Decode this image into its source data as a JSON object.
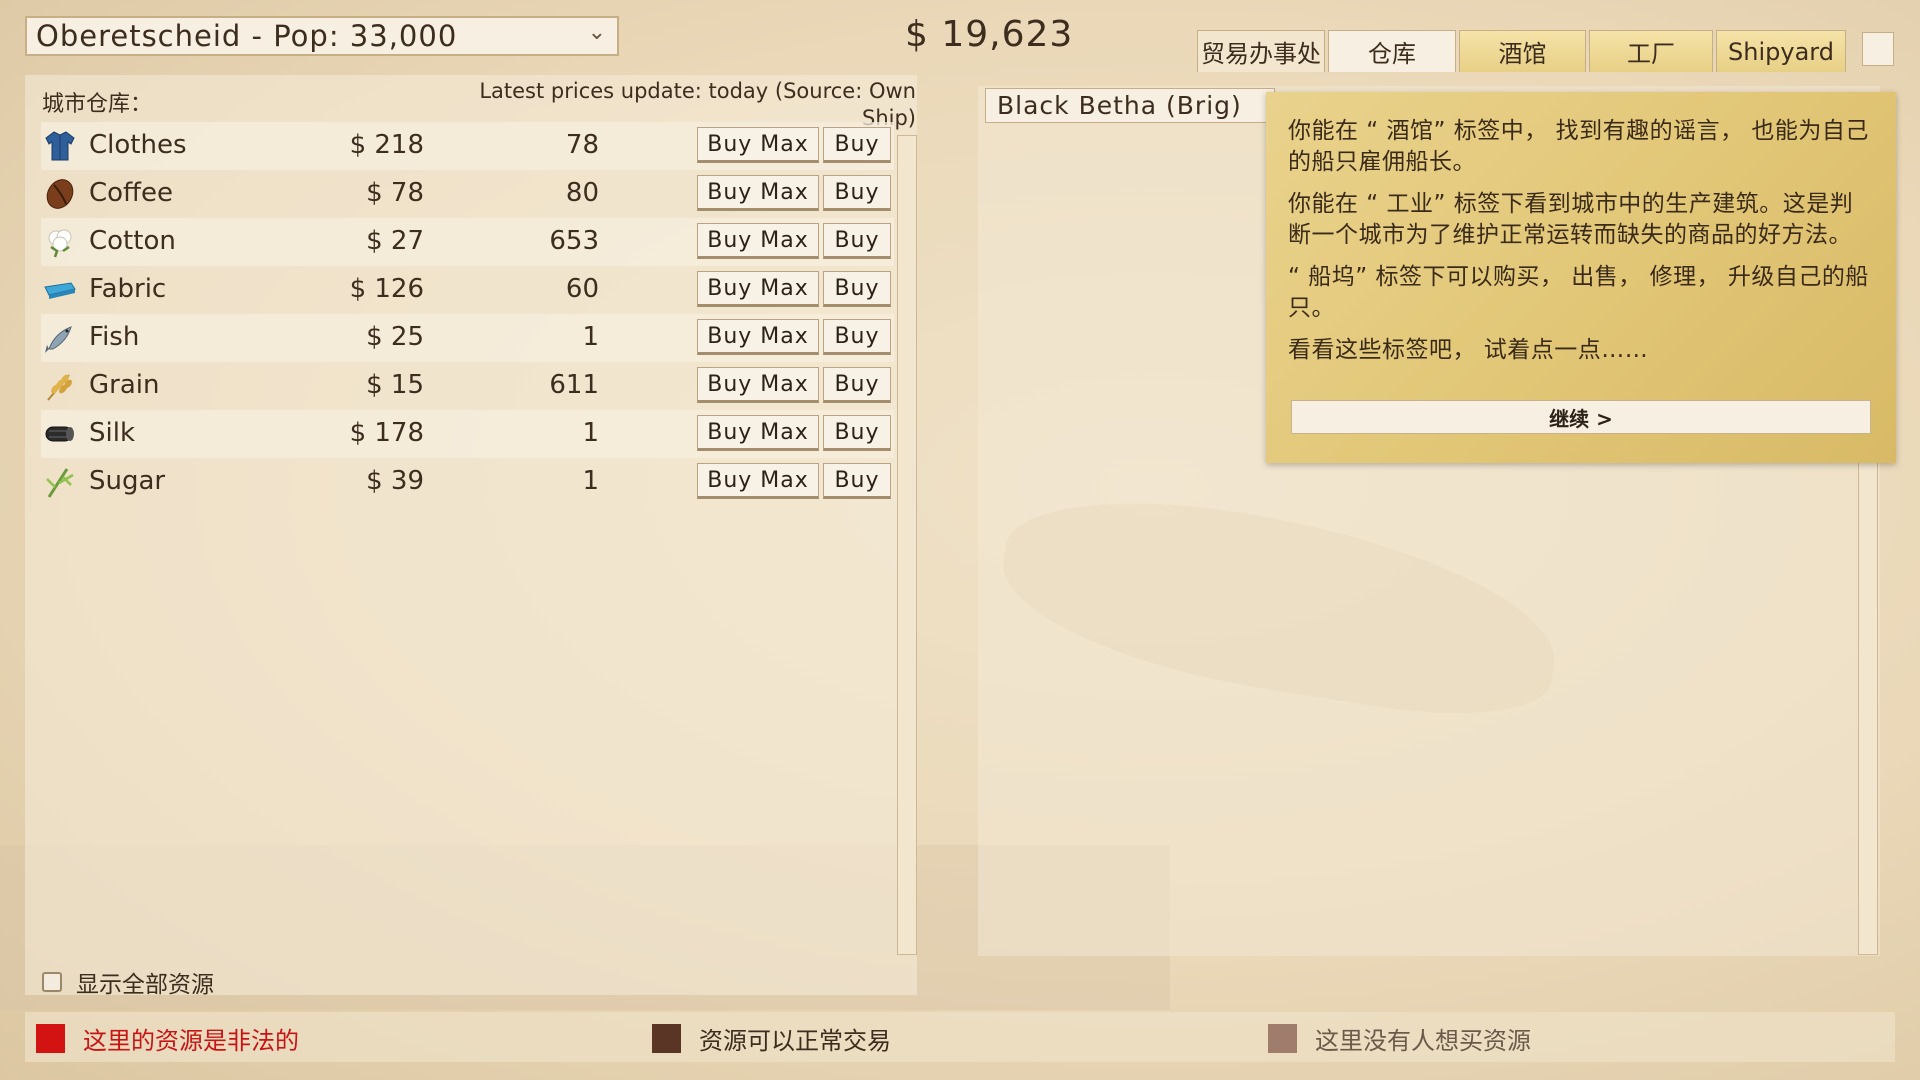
{
  "header": {
    "city_select_value": "Oberetscheid - Pop: 33,000",
    "money": "$ 19,623",
    "tabs": [
      {
        "label": "贸易办事处"
      },
      {
        "label": "仓库"
      },
      {
        "label": "酒馆"
      },
      {
        "label": "工厂"
      },
      {
        "label": "Shipyard"
      }
    ]
  },
  "warehouse": {
    "title": "城市仓库：",
    "price_note": "Latest prices update: today (Source: Own Ship)",
    "buy_max_label": "Buy Max",
    "buy_label": "Buy",
    "rows": [
      {
        "name": "Clothes",
        "price": "$ 218",
        "qty": "78",
        "icon": "clothes-icon"
      },
      {
        "name": "Coffee",
        "price": "$ 78",
        "qty": "80",
        "icon": "coffee-icon"
      },
      {
        "name": "Cotton",
        "price": "$ 27",
        "qty": "653",
        "icon": "cotton-icon"
      },
      {
        "name": "Fabric",
        "price": "$ 126",
        "qty": "60",
        "icon": "fabric-icon"
      },
      {
        "name": "Fish",
        "price": "$ 25",
        "qty": "1",
        "icon": "fish-icon"
      },
      {
        "name": "Grain",
        "price": "$ 15",
        "qty": "611",
        "icon": "grain-icon"
      },
      {
        "name": "Silk",
        "price": "$ 178",
        "qty": "1",
        "icon": "silk-icon"
      },
      {
        "name": "Sugar",
        "price": "$ 39",
        "qty": "1",
        "icon": "sugar-icon"
      }
    ],
    "show_all_label": "显示全部资源"
  },
  "ship": {
    "name": "Black Betha (Brig)"
  },
  "tooltip": {
    "para1": "你能在 “ 酒馆” 标签中， 找到有趣的谣言， 也能为自己的船只雇佣船长。",
    "para2": "你能在 “ 工业” 标签下看到城市中的生产建筑。这是判断一个城市为了维护正常运转而缺失的商品的好方法。",
    "para3": "“ 船坞” 标签下可以购买， 出售， 修理， 升级自己的船只。",
    "para4": "看看这些标签吧， 试着点一点……",
    "continue_label": "继续 >"
  },
  "legend": [
    {
      "label": "这里的资源是非法的",
      "color": "#d31212",
      "text_color": "#c81414"
    },
    {
      "label": "资源可以正常交易",
      "color": "#5a3424",
      "text_color": "#3d2d1f"
    },
    {
      "label": "这里没有人想买资源",
      "color": "#a07c6c",
      "text_color": "#6a5a4c"
    }
  ]
}
